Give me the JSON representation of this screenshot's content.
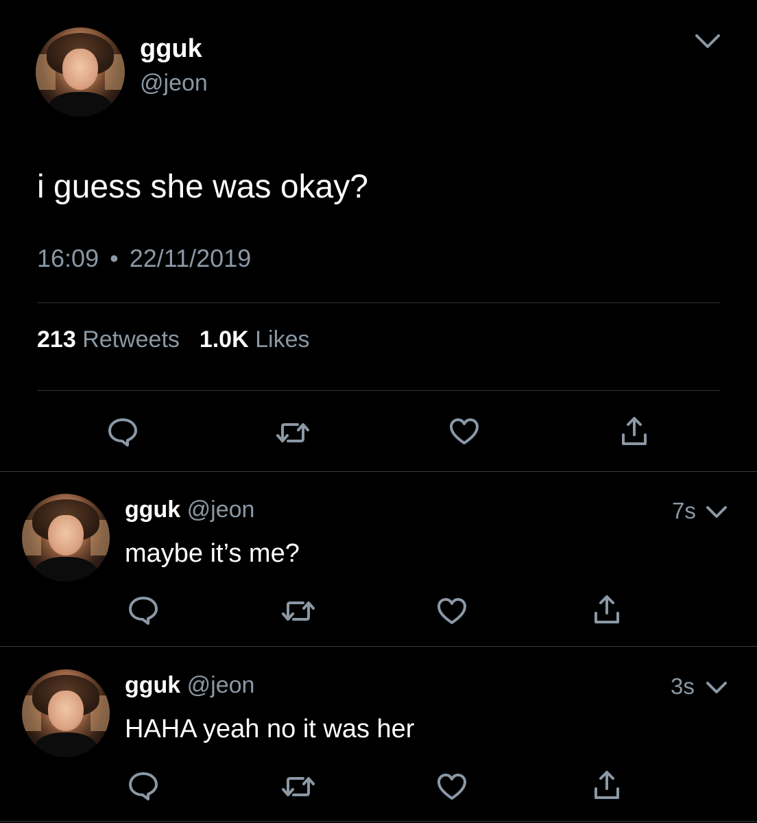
{
  "main_tweet": {
    "display_name": "gguk",
    "handle": "@jeon",
    "text": "i guess she was okay?",
    "time": "16:09",
    "separator": "•",
    "date": "22/11/2019",
    "retweets_count": "213",
    "retweets_label": "Retweets",
    "likes_count": "1.0K",
    "likes_label": "Likes"
  },
  "replies": [
    {
      "display_name": "gguk",
      "handle": "@jeon",
      "time": "7s",
      "text": "maybe it’s me?"
    },
    {
      "display_name": "gguk",
      "handle": "@jeon",
      "time": "3s",
      "text": "HAHA yeah no it was her"
    }
  ],
  "icons": {
    "reply": "reply-icon",
    "retweet": "retweet-icon",
    "like": "heart-icon",
    "share": "share-icon",
    "more": "chevron-down-icon"
  },
  "colors": {
    "background": "#000000",
    "text": "#ffffff",
    "secondary_text": "#8b98a5",
    "divider": "#2f3336"
  }
}
